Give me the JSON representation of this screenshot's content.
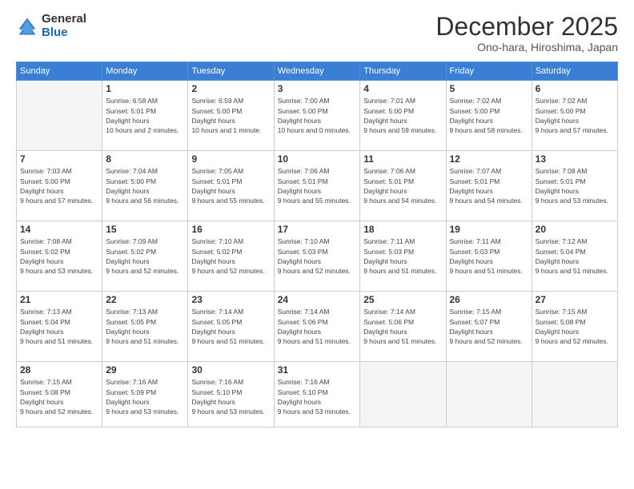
{
  "logo": {
    "general": "General",
    "blue": "Blue"
  },
  "header": {
    "month": "December 2025",
    "location": "Ono-hara, Hiroshima, Japan"
  },
  "weekdays": [
    "Sunday",
    "Monday",
    "Tuesday",
    "Wednesday",
    "Thursday",
    "Friday",
    "Saturday"
  ],
  "weeks": [
    [
      {
        "day": "",
        "empty": true
      },
      {
        "day": "1",
        "sunrise": "6:58 AM",
        "sunset": "5:01 PM",
        "daylight": "10 hours and 2 minutes."
      },
      {
        "day": "2",
        "sunrise": "6:59 AM",
        "sunset": "5:00 PM",
        "daylight": "10 hours and 1 minute."
      },
      {
        "day": "3",
        "sunrise": "7:00 AM",
        "sunset": "5:00 PM",
        "daylight": "10 hours and 0 minutes."
      },
      {
        "day": "4",
        "sunrise": "7:01 AM",
        "sunset": "5:00 PM",
        "daylight": "9 hours and 59 minutes."
      },
      {
        "day": "5",
        "sunrise": "7:02 AM",
        "sunset": "5:00 PM",
        "daylight": "9 hours and 58 minutes."
      },
      {
        "day": "6",
        "sunrise": "7:02 AM",
        "sunset": "5:00 PM",
        "daylight": "9 hours and 57 minutes."
      }
    ],
    [
      {
        "day": "7",
        "sunrise": "7:03 AM",
        "sunset": "5:00 PM",
        "daylight": "9 hours and 57 minutes."
      },
      {
        "day": "8",
        "sunrise": "7:04 AM",
        "sunset": "5:00 PM",
        "daylight": "9 hours and 56 minutes."
      },
      {
        "day": "9",
        "sunrise": "7:05 AM",
        "sunset": "5:01 PM",
        "daylight": "9 hours and 55 minutes."
      },
      {
        "day": "10",
        "sunrise": "7:06 AM",
        "sunset": "5:01 PM",
        "daylight": "9 hours and 55 minutes."
      },
      {
        "day": "11",
        "sunrise": "7:06 AM",
        "sunset": "5:01 PM",
        "daylight": "9 hours and 54 minutes."
      },
      {
        "day": "12",
        "sunrise": "7:07 AM",
        "sunset": "5:01 PM",
        "daylight": "9 hours and 54 minutes."
      },
      {
        "day": "13",
        "sunrise": "7:08 AM",
        "sunset": "5:01 PM",
        "daylight": "9 hours and 53 minutes."
      }
    ],
    [
      {
        "day": "14",
        "sunrise": "7:08 AM",
        "sunset": "5:02 PM",
        "daylight": "9 hours and 53 minutes."
      },
      {
        "day": "15",
        "sunrise": "7:09 AM",
        "sunset": "5:02 PM",
        "daylight": "9 hours and 52 minutes."
      },
      {
        "day": "16",
        "sunrise": "7:10 AM",
        "sunset": "5:02 PM",
        "daylight": "9 hours and 52 minutes."
      },
      {
        "day": "17",
        "sunrise": "7:10 AM",
        "sunset": "5:03 PM",
        "daylight": "9 hours and 52 minutes."
      },
      {
        "day": "18",
        "sunrise": "7:11 AM",
        "sunset": "5:03 PM",
        "daylight": "9 hours and 51 minutes."
      },
      {
        "day": "19",
        "sunrise": "7:11 AM",
        "sunset": "5:03 PM",
        "daylight": "9 hours and 51 minutes."
      },
      {
        "day": "20",
        "sunrise": "7:12 AM",
        "sunset": "5:04 PM",
        "daylight": "9 hours and 51 minutes."
      }
    ],
    [
      {
        "day": "21",
        "sunrise": "7:13 AM",
        "sunset": "5:04 PM",
        "daylight": "9 hours and 51 minutes."
      },
      {
        "day": "22",
        "sunrise": "7:13 AM",
        "sunset": "5:05 PM",
        "daylight": "9 hours and 51 minutes."
      },
      {
        "day": "23",
        "sunrise": "7:14 AM",
        "sunset": "5:05 PM",
        "daylight": "9 hours and 51 minutes."
      },
      {
        "day": "24",
        "sunrise": "7:14 AM",
        "sunset": "5:06 PM",
        "daylight": "9 hours and 51 minutes."
      },
      {
        "day": "25",
        "sunrise": "7:14 AM",
        "sunset": "5:06 PM",
        "daylight": "9 hours and 51 minutes."
      },
      {
        "day": "26",
        "sunrise": "7:15 AM",
        "sunset": "5:07 PM",
        "daylight": "9 hours and 52 minutes."
      },
      {
        "day": "27",
        "sunrise": "7:15 AM",
        "sunset": "5:08 PM",
        "daylight": "9 hours and 52 minutes."
      }
    ],
    [
      {
        "day": "28",
        "sunrise": "7:15 AM",
        "sunset": "5:08 PM",
        "daylight": "9 hours and 52 minutes."
      },
      {
        "day": "29",
        "sunrise": "7:16 AM",
        "sunset": "5:09 PM",
        "daylight": "9 hours and 53 minutes."
      },
      {
        "day": "30",
        "sunrise": "7:16 AM",
        "sunset": "5:10 PM",
        "daylight": "9 hours and 53 minutes."
      },
      {
        "day": "31",
        "sunrise": "7:16 AM",
        "sunset": "5:10 PM",
        "daylight": "9 hours and 53 minutes."
      },
      {
        "day": "",
        "empty": true
      },
      {
        "day": "",
        "empty": true
      },
      {
        "day": "",
        "empty": true
      }
    ]
  ]
}
